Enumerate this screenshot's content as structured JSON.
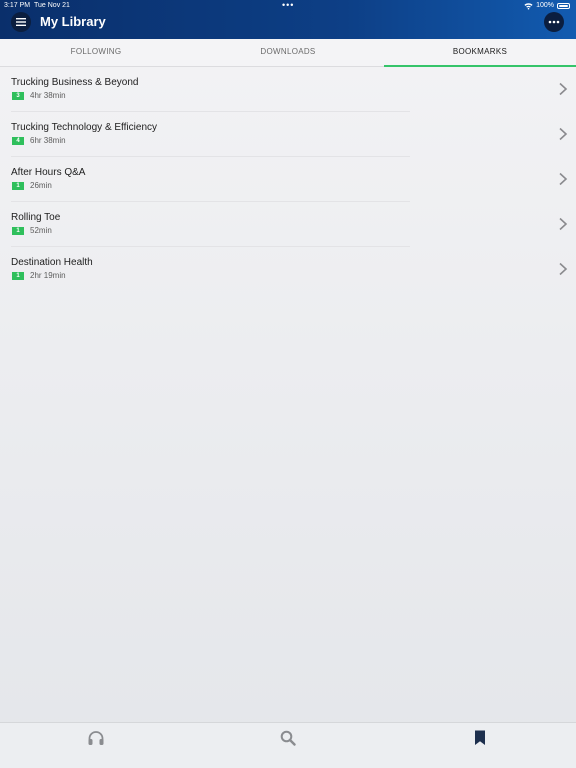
{
  "status_bar": {
    "time": "3:17 PM",
    "date": "Tue Nov 21",
    "dots": "•••",
    "battery": "100%"
  },
  "header": {
    "title": "My Library",
    "menu_icon": "hamburger-icon",
    "more_icon": "more-icon"
  },
  "tabs": [
    {
      "label": "FOLLOWING",
      "active": false
    },
    {
      "label": "DOWNLOADS",
      "active": false
    },
    {
      "label": "BOOKMARKS",
      "active": true
    }
  ],
  "items": [
    {
      "title": "Trucking Business & Beyond",
      "count": "3",
      "duration": "4hr 38min"
    },
    {
      "title": "Trucking Technology & Efficiency",
      "count": "4",
      "duration": "6hr 38min"
    },
    {
      "title": "After Hours Q&A",
      "count": "1",
      "duration": "26min"
    },
    {
      "title": "Rolling Toe",
      "count": "1",
      "duration": "52min"
    },
    {
      "title": "Destination Health",
      "count": "1",
      "duration": "2hr 19min"
    }
  ],
  "bottom_nav": [
    {
      "icon": "headphones-icon",
      "active": false
    },
    {
      "icon": "search-icon",
      "active": false
    },
    {
      "icon": "bookmark-icon",
      "active": true
    }
  ],
  "colors": {
    "header": "#0d3f86",
    "accent": "#35c46a",
    "badge": "#2fbf5c"
  }
}
